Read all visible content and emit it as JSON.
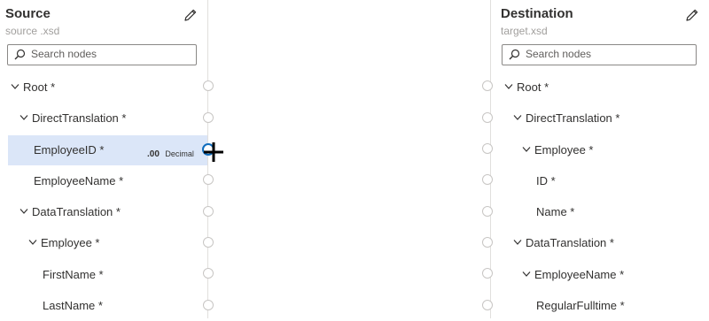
{
  "source": {
    "title": "Source",
    "file": "source .xsd",
    "search_placeholder": "Search nodes",
    "nodes": [
      {
        "label": "Root *"
      },
      {
        "label": "DirectTranslation *"
      },
      {
        "label": "EmployeeID *",
        "type_icon": ".00",
        "type_label": "Decimal"
      },
      {
        "label": "EmployeeName *"
      },
      {
        "label": "DataTranslation *"
      },
      {
        "label": "Employee *"
      },
      {
        "label": "FirstName *"
      },
      {
        "label": "LastName *"
      }
    ]
  },
  "destination": {
    "title": "Destination",
    "file": "target.xsd",
    "search_placeholder": "Search nodes",
    "nodes": [
      {
        "label": "Root *"
      },
      {
        "label": "DirectTranslation *"
      },
      {
        "label": "Employee *"
      },
      {
        "label": "ID *"
      },
      {
        "label": "Name *"
      },
      {
        "label": "DataTranslation *"
      },
      {
        "label": "EmployeeName *"
      },
      {
        "label": "RegularFulltime *"
      }
    ]
  },
  "icons": {
    "edit": "pencil-icon",
    "search": "search-icon",
    "expand": "chevron-down-icon",
    "cursor": "crosshair-plus-icon"
  },
  "colors": {
    "selected_row": "#dbe6f8",
    "accent": "#0f6cbd",
    "border": "#e1dfdd"
  }
}
